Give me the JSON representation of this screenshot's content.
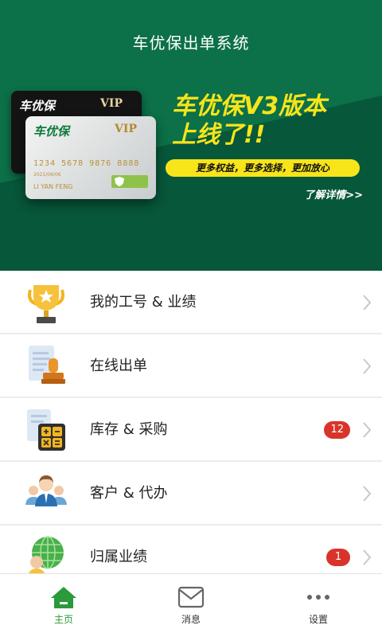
{
  "app": {
    "title": "车优保出单系统"
  },
  "banner": {
    "headline_line1": "车优保V3版本",
    "headline_line2": "上线了!!",
    "tagline": "更多权益，更多选择，更加放心",
    "more_link": "了解详情>>",
    "colors": {
      "background": "#0b6a44",
      "accent": "#f7e41a"
    },
    "card": {
      "brand": "车优保",
      "vip": "VIP",
      "number": "1234 5678 9876 8888",
      "date": "2021/06/06",
      "name": "LI YAN FENG"
    }
  },
  "menu": {
    "items": [
      {
        "label": "我的工号 & 业绩",
        "icon": "trophy-icon",
        "badge": ""
      },
      {
        "label": "在线出单",
        "icon": "document-stamp-icon",
        "badge": ""
      },
      {
        "label": "库存 & 采购",
        "icon": "calculator-icon",
        "badge": "12"
      },
      {
        "label": "客户 & 代办",
        "icon": "customers-icon",
        "badge": ""
      },
      {
        "label": "归属业绩",
        "icon": "globe-person-icon",
        "badge": "1"
      }
    ]
  },
  "tabbar": {
    "items": [
      {
        "label": "主页",
        "icon": "home-icon",
        "active": true
      },
      {
        "label": "消息",
        "icon": "mail-icon",
        "active": false
      },
      {
        "label": "设置",
        "icon": "more-dots-icon",
        "active": false
      }
    ],
    "active_color": "#2a9a3a"
  },
  "badge_color": "#d9342b"
}
